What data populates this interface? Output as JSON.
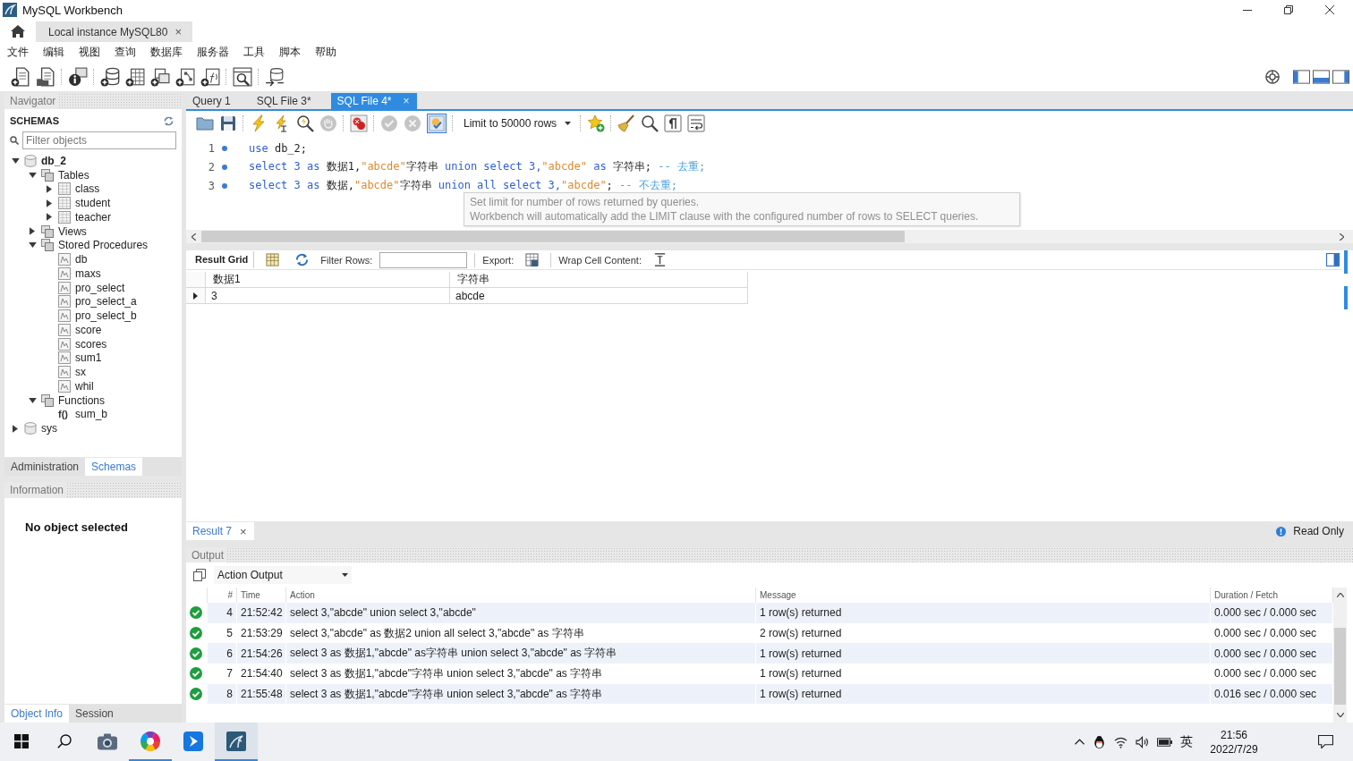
{
  "window": {
    "title": "MySQL Workbench"
  },
  "connection_tabs": [
    {
      "label": "Local instance MySQL80",
      "close": "×",
      "selected": true
    }
  ],
  "menu": [
    "文件",
    "编辑",
    "视图",
    "查询",
    "数据库",
    "服务器",
    "工具",
    "脚本",
    "帮助"
  ],
  "navigator": {
    "title": "Navigator",
    "section": "SCHEMAS",
    "filter": {
      "placeholder": "Filter objects"
    },
    "tree": [
      {
        "label": "db_2",
        "kind": "schema",
        "default": true,
        "expanded": true,
        "children": [
          {
            "label": "Tables",
            "kind": "folder",
            "expanded": true,
            "children": [
              {
                "label": "class",
                "kind": "table",
                "expanded": false
              },
              {
                "label": "student",
                "kind": "table",
                "expanded": false
              },
              {
                "label": "teacher",
                "kind": "table",
                "expanded": false
              }
            ]
          },
          {
            "label": "Views",
            "kind": "folder",
            "expanded": false
          },
          {
            "label": "Stored Procedures",
            "kind": "folder",
            "expanded": true,
            "children": [
              {
                "label": "db",
                "kind": "procedure"
              },
              {
                "label": "maxs",
                "kind": "procedure"
              },
              {
                "label": "pro_select",
                "kind": "procedure"
              },
              {
                "label": "pro_select_a",
                "kind": "procedure"
              },
              {
                "label": "pro_select_b",
                "kind": "procedure"
              },
              {
                "label": "score",
                "kind": "procedure"
              },
              {
                "label": "scores",
                "kind": "procedure"
              },
              {
                "label": "sum1",
                "kind": "procedure"
              },
              {
                "label": "sx",
                "kind": "procedure"
              },
              {
                "label": "whil",
                "kind": "procedure"
              }
            ]
          },
          {
            "label": "Functions",
            "kind": "folder",
            "expanded": true,
            "children": [
              {
                "label": "sum_b",
                "kind": "function",
                "icon": "f()"
              }
            ]
          }
        ]
      },
      {
        "label": "sys",
        "kind": "schema",
        "default": false,
        "expanded": false
      }
    ],
    "tabs": [
      {
        "label": "Administration",
        "selected": false
      },
      {
        "label": "Schemas",
        "selected": true
      }
    ],
    "information": {
      "title": "Information",
      "message": "No object selected"
    },
    "bottom_tabs": [
      {
        "label": "Object Info",
        "selected": true
      },
      {
        "label": "Session",
        "selected": false
      }
    ]
  },
  "editor": {
    "tabs": [
      {
        "label": "Query 1",
        "selected": false
      },
      {
        "label": "SQL File 3*",
        "selected": false
      },
      {
        "label": "SQL File 4*",
        "selected": true,
        "close": "×"
      }
    ],
    "auto_commit": true,
    "limit": "Limit to 50000 rows",
    "lines": [
      {
        "number": "1",
        "tokens": [
          {
            "text": "use",
            "kind": "keyword"
          },
          {
            "text": " db_2;",
            "kind": "plain"
          }
        ]
      },
      {
        "number": "2",
        "tokens": [
          {
            "text": "select 3 as",
            "kind": "keyword"
          },
          {
            "text": " 数据1,",
            "kind": "plain"
          },
          {
            "text": "\"abcde\"",
            "kind": "string"
          },
          {
            "text": "字符串 ",
            "kind": "plain"
          },
          {
            "text": "union select 3,",
            "kind": "keyword"
          },
          {
            "text": "\"abcde\"",
            "kind": "string"
          },
          {
            "text": " as",
            "kind": "keyword"
          },
          {
            "text": " 字符串;",
            "kind": "plain"
          },
          {
            "text": " -- 去重;",
            "kind": "comment"
          }
        ]
      },
      {
        "number": "3",
        "tokens": [
          {
            "text": "select 3 as",
            "kind": "keyword"
          },
          {
            "text": " 数据,",
            "kind": "plain"
          },
          {
            "text": "\"abcde\"",
            "kind": "string"
          },
          {
            "text": "字符串 ",
            "kind": "plain"
          },
          {
            "text": "union all select 3,",
            "kind": "keyword"
          },
          {
            "text": "\"abcde\"",
            "kind": "string"
          },
          {
            "text": ";",
            "kind": "plain"
          },
          {
            "text": " -- 不去重;",
            "kind": "comment"
          }
        ]
      }
    ],
    "tooltip": [
      "Set limit for number of rows returned by queries.",
      "Workbench will automatically add the LIMIT clause with the configured number of rows to SELECT queries."
    ]
  },
  "result": {
    "view": {
      "label": "Result Grid",
      "selected": true
    },
    "filter_label": "Filter Rows:",
    "export_label": "Export:",
    "wrap_label": "Wrap Cell Content:",
    "columns": [
      "数据1",
      "字符串"
    ],
    "rows": [
      {
        "cells": [
          "3",
          "abcde"
        ],
        "current": true
      }
    ],
    "tabs": [
      {
        "label": "Result 7",
        "close": "×",
        "selected": true
      }
    ],
    "status": "Read Only"
  },
  "output": {
    "title": "Output",
    "selector": "Action Output",
    "columns": [
      "#",
      "Time",
      "Action",
      "Message",
      "Duration / Fetch"
    ],
    "rows": [
      {
        "succeeded": true,
        "number": "4",
        "time": "21:52:42",
        "action": "select 3,\"abcde\" union select 3,\"abcde\"",
        "message": "1 row(s) returned",
        "duration": "0.000 sec / 0.000 sec"
      },
      {
        "succeeded": true,
        "number": "5",
        "time": "21:53:29",
        "action": "select 3,\"abcde\" as 数据2 union all select 3,\"abcde\" as 字符串",
        "message": "2 row(s) returned",
        "duration": "0.000 sec / 0.000 sec"
      },
      {
        "succeeded": true,
        "number": "6",
        "time": "21:54:26",
        "action": "select 3 as 数据1,\"abcde\" as字符串 union select 3,\"abcde\" as 字符串",
        "message": "1 row(s) returned",
        "duration": "0.000 sec / 0.000 sec"
      },
      {
        "succeeded": true,
        "number": "7",
        "time": "21:54:40",
        "action": "select 3 as 数据1,\"abcde\"字符串 union select 3,\"abcde\" as 字符串",
        "message": "1 row(s) returned",
        "duration": "0.000 sec / 0.000 sec"
      },
      {
        "succeeded": true,
        "number": "8",
        "time": "21:55:48",
        "action": "select 3 as 数据1,\"abcde\"字符串 union select 3,\"abcde\" as 字符串",
        "message": "1 row(s) returned",
        "duration": "0.016 sec / 0.000 sec"
      }
    ]
  },
  "taskbar": {
    "apps": [
      {
        "kind": "camera",
        "running": false,
        "active": false
      },
      {
        "kind": "wheel",
        "running": true,
        "active": false
      },
      {
        "kind": "play",
        "running": false,
        "active": false
      },
      {
        "kind": "swoosh",
        "running": true,
        "active": true
      }
    ],
    "ime": "英",
    "time": "21:56",
    "date": "2022/7/29"
  }
}
